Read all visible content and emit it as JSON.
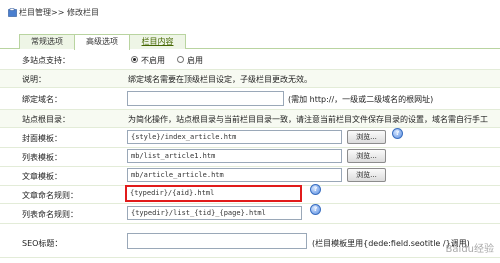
{
  "header": {
    "section": "栏目管理",
    "separator": ">>",
    "page": "修改栏目"
  },
  "tabs": [
    {
      "label": "常规选项"
    },
    {
      "label": "高级选项"
    },
    {
      "label": "栏目内容"
    }
  ],
  "form": {
    "multisite": {
      "label": "多站点支持：",
      "option_off": "不启用",
      "option_on": "启用",
      "selected": "不启用"
    },
    "note": {
      "label": "说明：",
      "text": "绑定域名需要在顶级栏目设定，子级栏目更改无效。"
    },
    "domain": {
      "label": "绑定域名：",
      "value": "",
      "hint": "(需加 http://，一级或二级域名的根网址)"
    },
    "site_root": {
      "label": "站点根目录：",
      "text": "为简化操作，站点根目录与当前栏目目录一致，请注意当前栏目文件保存目录的设置，域名需自行手工"
    },
    "cover_template": {
      "label": "封面模板：",
      "value": "{style}/index_article.htm",
      "button": "浏览..."
    },
    "list_template": {
      "label": "列表模板：",
      "value": "mb/list_article1.htm",
      "button": "浏览..."
    },
    "article_template": {
      "label": "文章模板：",
      "value": "mb/article_article.htm",
      "button": "浏览..."
    },
    "article_naming": {
      "label": "文章命名规则：",
      "value": "{typedir}/{aid}.html"
    },
    "list_naming": {
      "label": "列表命名规则：",
      "value": "{typedir}/list_{tid}_{page}.html"
    },
    "seo_title": {
      "label": "SEO标题：",
      "value": "",
      "hint": "(栏目模板里用{dede:field.seotitle /}调用)"
    }
  },
  "watermark": "Baidu经验"
}
